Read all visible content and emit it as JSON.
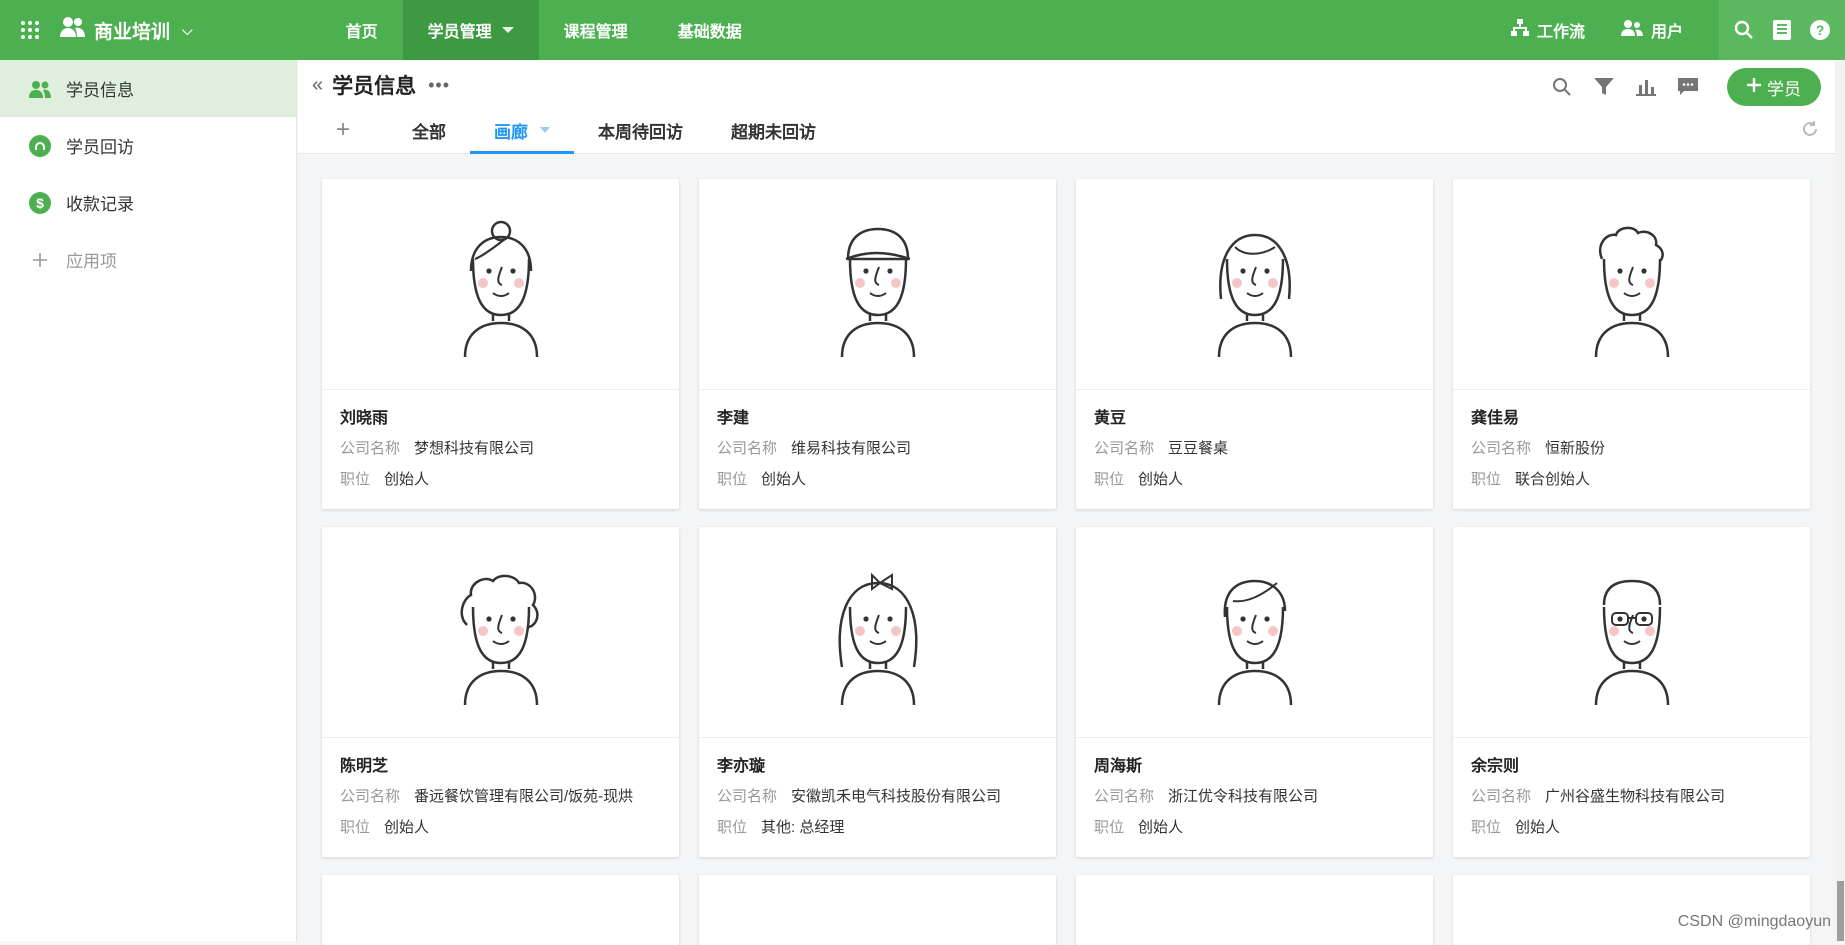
{
  "app": {
    "name": "商业培训"
  },
  "nav": [
    {
      "label": "首页"
    },
    {
      "label": "学员管理",
      "active": true
    },
    {
      "label": "课程管理"
    },
    {
      "label": "基础数据"
    }
  ],
  "top_links": {
    "workflow": "工作流",
    "users": "用户"
  },
  "sidebar": {
    "items": [
      {
        "label": "学员信息",
        "icon": "users-icon",
        "active": true
      },
      {
        "label": "学员回访",
        "icon": "headset-icon"
      },
      {
        "label": "收款记录",
        "icon": "dollar-icon"
      }
    ],
    "add_label": "应用项"
  },
  "page": {
    "title": "学员信息",
    "add_button": "学员"
  },
  "tabs": [
    {
      "label": "全部"
    },
    {
      "label": "画廊",
      "active": true
    },
    {
      "label": "本周待回访"
    },
    {
      "label": "超期未回访"
    }
  ],
  "labels": {
    "company": "公司名称",
    "position": "职位"
  },
  "students": [
    {
      "name": "刘晓雨",
      "company": "梦想科技有限公司",
      "position": "创始人",
      "avatar": "girl-bun"
    },
    {
      "name": "李建",
      "company": "维易科技有限公司",
      "position": "创始人",
      "avatar": "boy-cap"
    },
    {
      "name": "黄豆",
      "company": "豆豆餐桌",
      "position": "创始人",
      "avatar": "girl-bob"
    },
    {
      "name": "龚佳易",
      "company": "恒新股份",
      "position": "联合创始人",
      "avatar": "boy-curly"
    },
    {
      "name": "陈明芝",
      "company": "番远餐饮管理有限公司/饭苑-现烘",
      "position": "创始人",
      "avatar": "curly"
    },
    {
      "name": "李亦璇",
      "company": "安徽凯禾电气科技股份有限公司",
      "position": "其他: 总经理",
      "avatar": "girl-bow"
    },
    {
      "name": "周海斯",
      "company": "浙江优令科技有限公司",
      "position": "创始人",
      "avatar": "girl-short"
    },
    {
      "name": "余宗则",
      "company": "广州谷盛生物科技有限公司",
      "position": "创始人",
      "avatar": "boy-glasses"
    }
  ],
  "watermark": "CSDN @mingdaoyun",
  "colors": {
    "brand": "#4caf50",
    "tab_active": "#2196f3"
  }
}
